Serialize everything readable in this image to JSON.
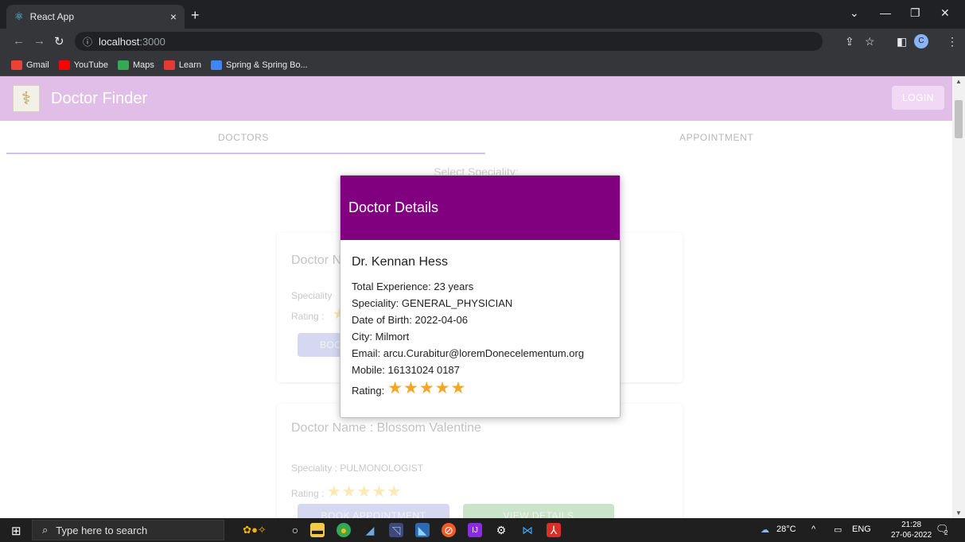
{
  "browser": {
    "tab_title": "React App",
    "tab_close": "×",
    "new_tab": "+",
    "url_host": "localhost",
    "url_port": ":3000",
    "bookmarks": [
      {
        "label": "Gmail",
        "color": "#ea4335"
      },
      {
        "label": "YouTube",
        "color": "#ff0000"
      },
      {
        "label": "Maps",
        "color": "#34a853"
      },
      {
        "label": "Learn",
        "color": "#e53935"
      },
      {
        "label": "Spring & Spring Bo...",
        "color": "#4285f4"
      }
    ],
    "profile_initial": "C"
  },
  "app": {
    "title": "Doctor Finder",
    "login_label": "LOGIN",
    "tabs": [
      {
        "label": "DOCTORS"
      },
      {
        "label": "APPOINTMENT"
      }
    ],
    "speciality_label": "Select Speciality:"
  },
  "cards": [
    {
      "name": "Doctor N",
      "speciality": "Speciality",
      "rating_label": "Rating :",
      "book_label": "BOO"
    },
    {
      "name": "Doctor Name : Blossom Valentine",
      "speciality": "Speciality : PULMONOLOGIST",
      "rating_label": "Rating :",
      "stars": "★★★★★",
      "book_label": "BOOK APPOINTMENT",
      "view_label": "VIEW DETAILS"
    }
  ],
  "dialog": {
    "header": "Doctor Details",
    "doctor_name": "Dr. Kennan Hess",
    "experience": "Total Experience: 23 years",
    "speciality": "Speciality: GENERAL_PHYSICIAN",
    "dob": "Date of Birth: 2022-04-06",
    "city": "City: Milmort",
    "email": "Email: arcu.Curabitur@loremDonecelementum.org",
    "mobile": "Mobile: 16131024 0187",
    "rating_label": "Rating:",
    "rating_value": 5,
    "stars": "★★★★★",
    "header_color": "#800080"
  },
  "taskbar": {
    "search_placeholder": "Type here to search",
    "weather": "28°C",
    "language": "ENG",
    "time": "21:28",
    "date": "27-06-2022",
    "notifications": "2"
  }
}
